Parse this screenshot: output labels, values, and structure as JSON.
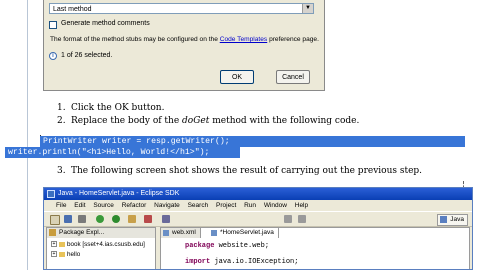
{
  "dialog": {
    "selected_method": "Last method",
    "generate_comments_label": "Generate method comments",
    "info_prefix": "The format of the method stubs may be configured on the ",
    "info_link": "Code Templates",
    "info_suffix": " preference page.",
    "status": "1 of 26 selected.",
    "ok_label": "OK",
    "cancel_label": "Cancel"
  },
  "steps": [
    {
      "num": "1.",
      "text": "Click the OK button."
    },
    {
      "num": "2.",
      "text_prefix": "Replace the body of the ",
      "method": "doGet",
      "text_suffix": " method with the following code."
    },
    {
      "num": "3.",
      "text": "The following screen shot shows the result of carrying out the previous step."
    }
  ],
  "code_lines": [
    "PrintWriter writer = resp.getWriter();",
    "writer.println(\"<h1>Hello, World!</h1>\");"
  ],
  "eclipse": {
    "title": "Java - HomeServlet.java - Eclipse SDK",
    "menu": [
      "File",
      "Edit",
      "Source",
      "Refactor",
      "Navigate",
      "Search",
      "Project",
      "Run",
      "Window",
      "Help"
    ],
    "perspective": "Java",
    "package_explorer_title": "Package Expl...",
    "tree": [
      "book [sset+4.ias.csusb.edu]",
      "hello"
    ],
    "editor_tabs": [
      "web.xml",
      "*HomeServlet.java"
    ],
    "code": {
      "line1_kw": "package",
      "line1_rest": " website.web;",
      "line2_kw": "import",
      "line2_rest": " java.io.IOException;"
    }
  }
}
